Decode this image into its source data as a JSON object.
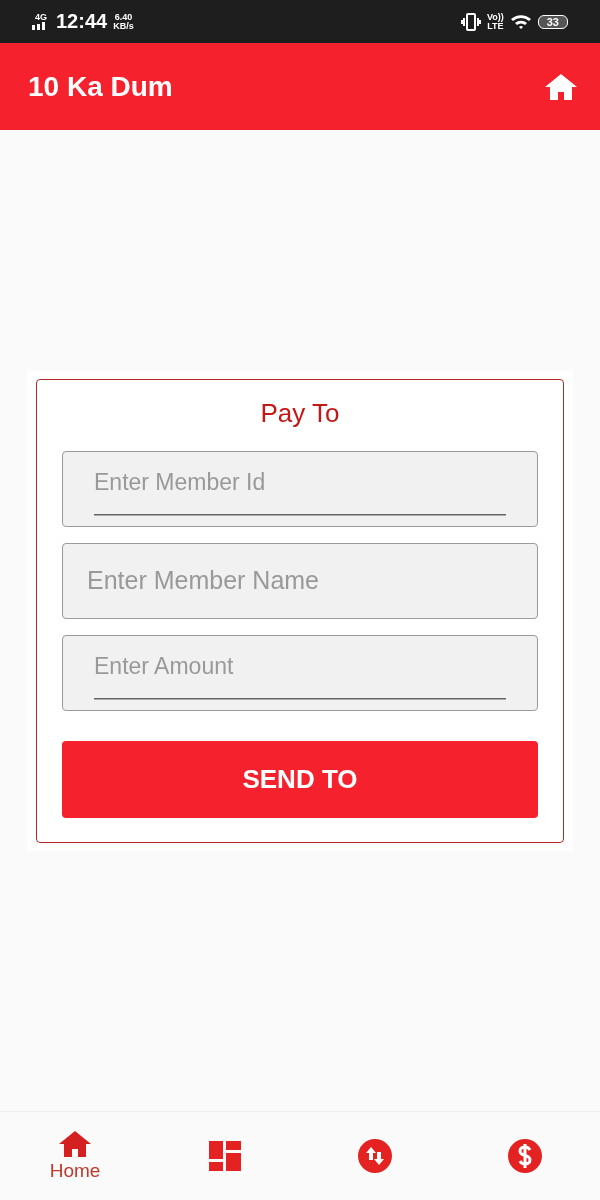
{
  "status_bar": {
    "network": "4G",
    "time": "12:44",
    "speed": "6.40",
    "speed_unit": "KB/s",
    "volte": "Vo))",
    "lte": "LTE",
    "battery": "33"
  },
  "app_bar": {
    "title": "10 Ka Dum"
  },
  "form": {
    "title": "Pay To",
    "fields": [
      {
        "placeholder": "Enter Member Id",
        "kind": "underlined"
      },
      {
        "placeholder": "Enter Member Name",
        "kind": "plain"
      },
      {
        "placeholder": "Enter Amount",
        "kind": "underlined"
      }
    ],
    "button": "SEND TO"
  },
  "bottom_nav": [
    {
      "label": "Home",
      "selected": true
    },
    {
      "selected": false
    },
    {
      "selected": false
    },
    {
      "selected": false
    }
  ]
}
